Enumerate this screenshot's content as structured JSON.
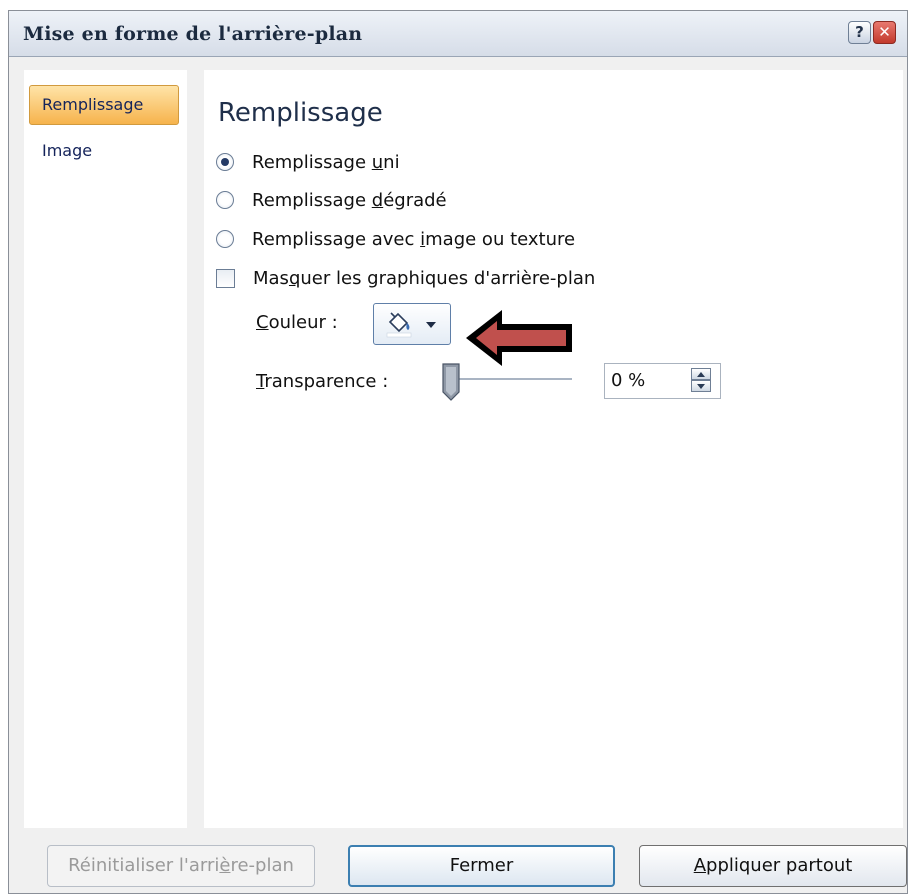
{
  "window": {
    "title": "Mise en forme de l'arrière-plan",
    "help_label": "?",
    "close_label": "✕"
  },
  "sidebar": {
    "items": [
      {
        "label": "Remplissage",
        "selected": true
      },
      {
        "label": "Image",
        "selected": false
      }
    ]
  },
  "panel": {
    "title": "Remplissage",
    "options": {
      "solid": {
        "pre": "Remplissage ",
        "ul": "u",
        "post": "ni",
        "checked": true
      },
      "gradient": {
        "pre": "Remplissage ",
        "ul": "d",
        "post": "égradé",
        "checked": false
      },
      "picture": {
        "pre": "Remplissage avec ",
        "ul": "i",
        "post": "mage ou texture",
        "checked": false
      }
    },
    "hide_graphics": {
      "pre": "Mas",
      "ul": "q",
      "post": "uer les graphiques d'arrière-plan",
      "checked": false
    },
    "color": {
      "ul": "C",
      "post": "ouleur :",
      "icon": "paint-bucket-icon"
    },
    "transparency": {
      "ul": "T",
      "post": "ransparence :",
      "value": "0 %",
      "fraction": 0
    }
  },
  "footer": {
    "reset": {
      "pre": "Réinitialiser l'arri",
      "ul": "è",
      "post": "re-plan"
    },
    "close": "Fermer",
    "apply": {
      "ul": "A",
      "post": "ppliquer partout"
    }
  },
  "colors": {
    "selected_tab": "#f6b34c",
    "annotation_arrow": "#c0504d"
  }
}
